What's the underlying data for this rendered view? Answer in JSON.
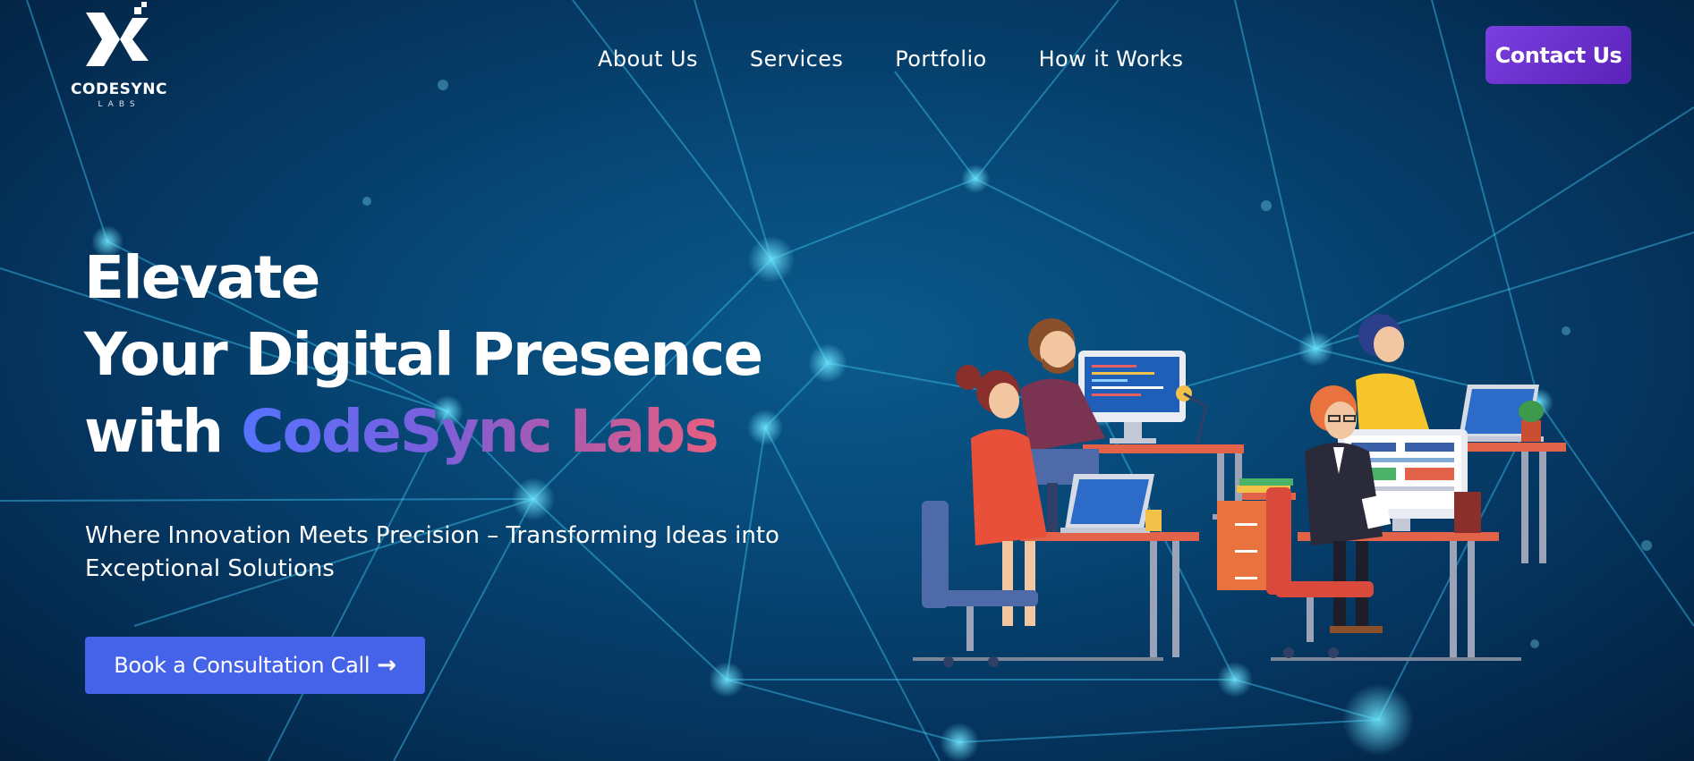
{
  "brand": {
    "logo_icon": "codesync-x-icon",
    "name": "CODESYNC",
    "tagline": "LABS"
  },
  "nav": {
    "items": [
      {
        "label": "About Us"
      },
      {
        "label": "Services"
      },
      {
        "label": "Portfolio"
      },
      {
        "label": "How it Works"
      }
    ]
  },
  "header": {
    "contact_label": "Contact Us"
  },
  "hero": {
    "title_line1": "Elevate",
    "title_line2": "Your Digital Presence",
    "title_line3_prefix": "with",
    "title_line3_accent": "CodeSync Labs",
    "subtitle": "Where Innovation Meets Precision – Transforming Ideas into Exceptional Solutions",
    "cta_label": "Book a Consultation Call",
    "cta_icon": "arrow-right-icon",
    "illustration": "developers-at-desks-illustration"
  },
  "colors": {
    "background": "#05355f",
    "contact_button": "#6a2fd0",
    "cta_button": "#4463e8",
    "accent_gradient_start": "#5673ff",
    "accent_gradient_end": "#e85f80"
  }
}
